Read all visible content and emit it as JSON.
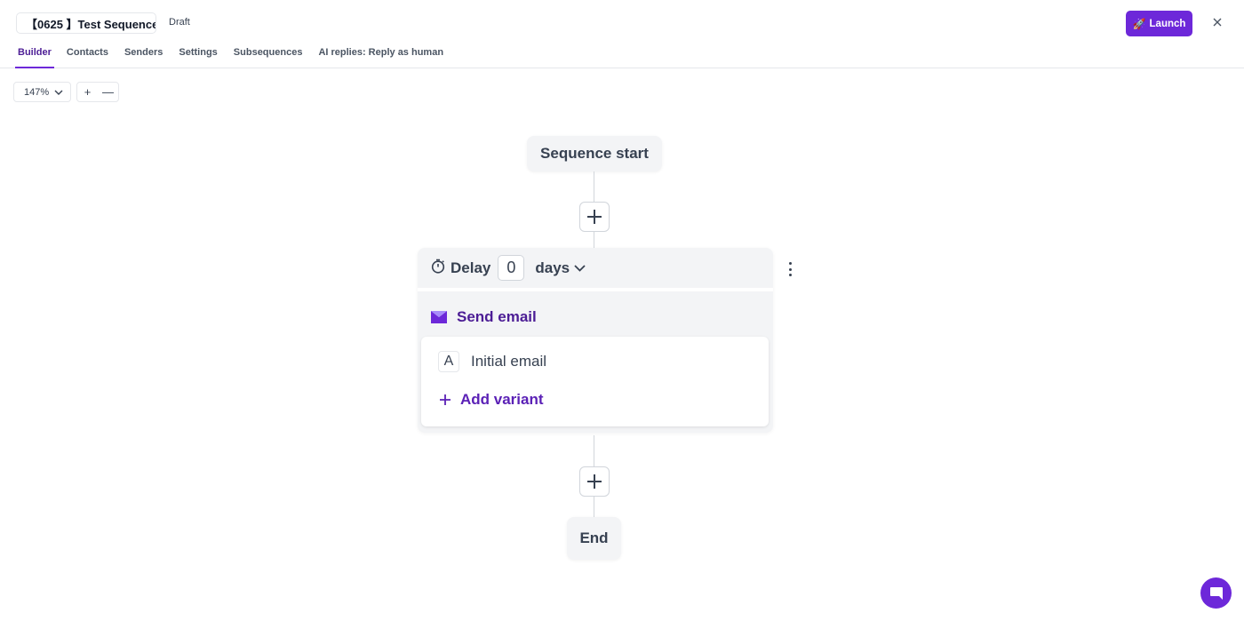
{
  "header": {
    "sequence_title": "【0625 】Test Sequence",
    "status": "Draft",
    "launch_label": "Launch",
    "launch_icon": "rocket-icon",
    "close_icon": "close-icon"
  },
  "tabs": [
    {
      "label": "Builder",
      "active": true
    },
    {
      "label": "Contacts",
      "active": false
    },
    {
      "label": "Senders",
      "active": false
    },
    {
      "label": "Settings",
      "active": false
    },
    {
      "label": "Subsequences",
      "active": false
    },
    {
      "label": "AI replies: Reply as human",
      "active": false
    }
  ],
  "zoom": {
    "level": "147%",
    "zoom_in_symbol": "+",
    "zoom_out_symbol": "—"
  },
  "flow": {
    "start_label": "Sequence start",
    "end_label": "End",
    "step": {
      "delay_label": "Delay",
      "delay_value": "0",
      "delay_unit": "days",
      "action_label": "Send email",
      "variants": [
        {
          "badge": "A",
          "name": "Initial email"
        }
      ],
      "add_variant_label": "Add variant"
    }
  },
  "colors": {
    "accent": "#6d28d9",
    "accent_text": "#4c1d95",
    "node_bg": "#f3f4f6"
  }
}
